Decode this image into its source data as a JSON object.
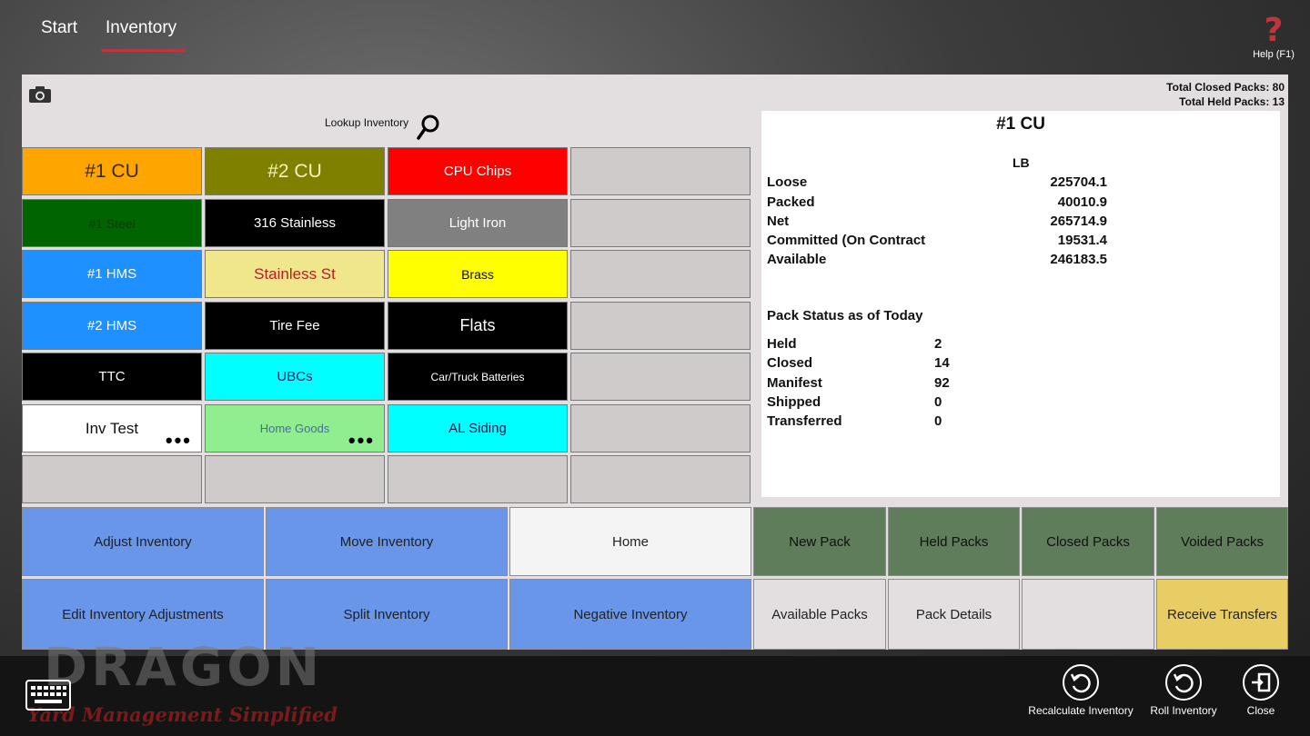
{
  "nav": {
    "start_label": "Start",
    "inventory_label": "Inventory",
    "help_label": "Help (F1)",
    "help_glyph": "?"
  },
  "header": {
    "total_closed": "Total Closed Packs: 80",
    "total_held": "Total Held Packs: 13",
    "lookup_label": "Lookup Inventory"
  },
  "commodities": [
    {
      "label": "#1 CU",
      "bg": "#ffa500",
      "fg": "#3a2a00",
      "size": 21
    },
    {
      "label": "#2 CU",
      "bg": "#808000",
      "fg": "#f4f0c0",
      "size": 21
    },
    {
      "label": "CPU Chips",
      "bg": "#ff0000",
      "fg": "#ffffff",
      "size": 15
    },
    {
      "label": "",
      "bg": "#cfcbcb",
      "fg": "#000000",
      "size": 15
    },
    {
      "label": "#1 Steel",
      "bg": "#006400",
      "fg": "#0b3a0b",
      "size": 14
    },
    {
      "label": "316 Stainless",
      "bg": "#000000",
      "fg": "#ffffff",
      "size": 15
    },
    {
      "label": "Light Iron",
      "bg": "#808080",
      "fg": "#ffffff",
      "size": 15
    },
    {
      "label": "",
      "bg": "#cfcbcb",
      "fg": "#000000",
      "size": 15
    },
    {
      "label": "#1 HMS",
      "bg": "#1e90ff",
      "fg": "#ffffff",
      "size": 15
    },
    {
      "label": "Stainless St",
      "bg": "#f0e68c",
      "fg": "#b22222",
      "size": 17
    },
    {
      "label": "Brass",
      "bg": "#ffff00",
      "fg": "#111111",
      "size": 14
    },
    {
      "label": "",
      "bg": "#cfcbcb",
      "fg": "#000000",
      "size": 15
    },
    {
      "label": "#2 HMS",
      "bg": "#1e90ff",
      "fg": "#ffffff",
      "size": 15
    },
    {
      "label": "Tire Fee",
      "bg": "#000000",
      "fg": "#ffffff",
      "size": 15
    },
    {
      "label": "Flats",
      "bg": "#000000",
      "fg": "#ffffff",
      "size": 18
    },
    {
      "label": "",
      "bg": "#cfcbcb",
      "fg": "#000000",
      "size": 15
    },
    {
      "label": "TTC",
      "bg": "#000000",
      "fg": "#ffffff",
      "size": 15
    },
    {
      "label": "UBCs",
      "bg": "#00ffff",
      "fg": "#1a1a6e",
      "size": 15
    },
    {
      "label": "Car/Truck Batteries",
      "bg": "#000000",
      "fg": "#ffffff",
      "size": 12
    },
    {
      "label": "",
      "bg": "#cfcbcb",
      "fg": "#000000",
      "size": 15
    },
    {
      "label": "Inv Test",
      "bg": "#ffffff",
      "fg": "#111111",
      "size": 17,
      "more": "•••"
    },
    {
      "label": "Home Goods",
      "bg": "#90ee90",
      "fg": "#4a6aa8",
      "size": 13,
      "more": "•••"
    },
    {
      "label": "AL Siding",
      "bg": "#00ffff",
      "fg": "#1a1a4e",
      "size": 15
    },
    {
      "label": "",
      "bg": "#cfcbcb",
      "fg": "#000000",
      "size": 15
    },
    {
      "label": "",
      "bg": "#cfcbcb",
      "fg": "#000000",
      "size": 15
    },
    {
      "label": "",
      "bg": "#cfcbcb",
      "fg": "#000000",
      "size": 15
    },
    {
      "label": "",
      "bg": "#cfcbcb",
      "fg": "#000000",
      "size": 15
    },
    {
      "label": "",
      "bg": "#cfcbcb",
      "fg": "#000000",
      "size": 15
    }
  ],
  "detail": {
    "title": "#1 CU",
    "unit": "LB",
    "quantities": [
      {
        "label": "Loose",
        "value": "225704.1"
      },
      {
        "label": "Packed",
        "value": "40010.9"
      },
      {
        "label": "Net",
        "value": "265714.9"
      },
      {
        "label": "Committed (On Contract",
        "value": "19531.4"
      },
      {
        "label": "Available",
        "value": "246183.5"
      }
    ],
    "section_title": "Pack Status as of Today",
    "pack_status": [
      {
        "label": "Held",
        "value": "2"
      },
      {
        "label": "Closed",
        "value": "14"
      },
      {
        "label": "Manifest",
        "value": "92"
      },
      {
        "label": "Shipped",
        "value": "0"
      },
      {
        "label": "Transferred",
        "value": "0"
      }
    ]
  },
  "actions": {
    "adjust": "Adjust Inventory",
    "move": "Move Inventory",
    "home": "Home",
    "new_pack": "New Pack",
    "held_packs": "Held Packs",
    "closed_packs": "Closed Packs",
    "voided_packs": "Voided Packs",
    "edit_adjust": "Edit Inventory Adjustments",
    "split": "Split Inventory",
    "negative": "Negative Inventory",
    "available_packs": "Available Packs",
    "pack_details": "Pack Details",
    "receive_transfers": "Receive Transfers"
  },
  "appbar": {
    "recalc": "Recalculate Inventory",
    "roll": "Roll Inventory",
    "close": "Close",
    "logo_text": "DRAGON",
    "logo_tagline": "Yard Management Simplified"
  }
}
